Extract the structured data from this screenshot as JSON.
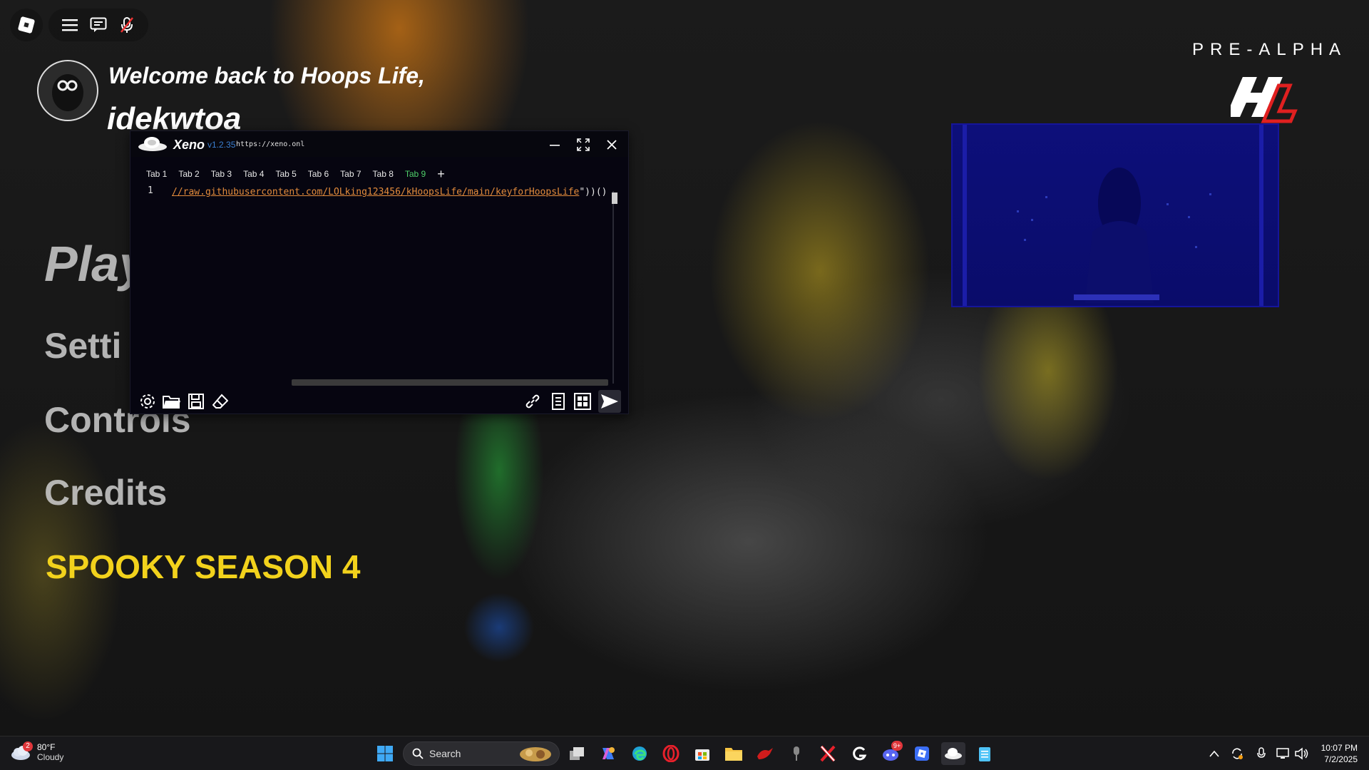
{
  "game": {
    "welcome": "Welcome back to Hoops Life,",
    "username": "idekwtoa",
    "menu": {
      "play": "Play",
      "settings": "Setti",
      "controls": "Controls",
      "credits": "Credits",
      "spooky": "SPOOKY SEASON 4"
    },
    "badge": "PRE-ALPHA",
    "logo_text": "HL",
    "accent": "#f2d21c"
  },
  "xeno": {
    "name": "Xeno",
    "version": "v1.2.35",
    "url": "https://xeno.onl",
    "tabs": [
      "Tab 1",
      "Tab 2",
      "Tab 3",
      "Tab 4",
      "Tab 5",
      "Tab 6",
      "Tab 7",
      "Tab 8",
      "Tab 9"
    ],
    "active_tab": "Tab 9",
    "add_tab": "+",
    "line_number": "1",
    "code_line": "//raw.githubusercontent.com/LOLking123456/kHoopsLife/main/keyforHoopsLife",
    "code_tail": "\"))()",
    "footer_left_icons": [
      "settings-icon",
      "folder-icon",
      "save-icon",
      "eraser-icon"
    ],
    "footer_right_icons": [
      "link-icon",
      "script-icon",
      "window-grid-icon",
      "execute-icon"
    ]
  },
  "taskbar": {
    "weather_temp": "80°F",
    "weather_desc": "Cloudy",
    "weather_badge": "2",
    "search_label": "Search",
    "discord_badge": "9+",
    "time": "10:07 PM",
    "date": "7/2/2025"
  }
}
